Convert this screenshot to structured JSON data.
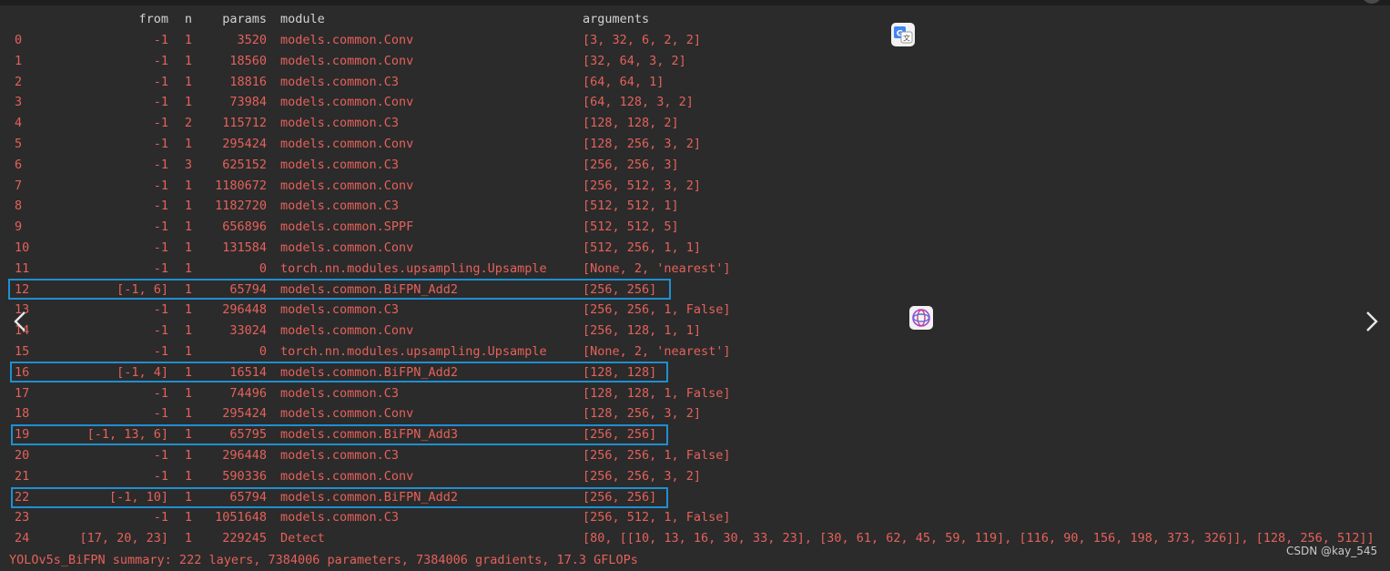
{
  "header": {
    "from": "from",
    "n": "n",
    "params": "params",
    "module": "module",
    "arguments": "arguments"
  },
  "rows": [
    {
      "idx": "0",
      "from": "-1",
      "n": "1",
      "params": "3520",
      "module": "models.common.Conv",
      "arguments": "[3, 32, 6, 2, 2]",
      "highlighted": false
    },
    {
      "idx": "1",
      "from": "-1",
      "n": "1",
      "params": "18560",
      "module": "models.common.Conv",
      "arguments": "[32, 64, 3, 2]",
      "highlighted": false
    },
    {
      "idx": "2",
      "from": "-1",
      "n": "1",
      "params": "18816",
      "module": "models.common.C3",
      "arguments": "[64, 64, 1]",
      "highlighted": false
    },
    {
      "idx": "3",
      "from": "-1",
      "n": "1",
      "params": "73984",
      "module": "models.common.Conv",
      "arguments": "[64, 128, 3, 2]",
      "highlighted": false
    },
    {
      "idx": "4",
      "from": "-1",
      "n": "2",
      "params": "115712",
      "module": "models.common.C3",
      "arguments": "[128, 128, 2]",
      "highlighted": false
    },
    {
      "idx": "5",
      "from": "-1",
      "n": "1",
      "params": "295424",
      "module": "models.common.Conv",
      "arguments": "[128, 256, 3, 2]",
      "highlighted": false
    },
    {
      "idx": "6",
      "from": "-1",
      "n": "3",
      "params": "625152",
      "module": "models.common.C3",
      "arguments": "[256, 256, 3]",
      "highlighted": false
    },
    {
      "idx": "7",
      "from": "-1",
      "n": "1",
      "params": "1180672",
      "module": "models.common.Conv",
      "arguments": "[256, 512, 3, 2]",
      "highlighted": false
    },
    {
      "idx": "8",
      "from": "-1",
      "n": "1",
      "params": "1182720",
      "module": "models.common.C3",
      "arguments": "[512, 512, 1]",
      "highlighted": false
    },
    {
      "idx": "9",
      "from": "-1",
      "n": "1",
      "params": "656896",
      "module": "models.common.SPPF",
      "arguments": "[512, 512, 5]",
      "highlighted": false
    },
    {
      "idx": "10",
      "from": "-1",
      "n": "1",
      "params": "131584",
      "module": "models.common.Conv",
      "arguments": "[512, 256, 1, 1]",
      "highlighted": false
    },
    {
      "idx": "11",
      "from": "-1",
      "n": "1",
      "params": "0",
      "module": "torch.nn.modules.upsampling.Upsample",
      "arguments": "[None, 2, 'nearest']",
      "highlighted": false
    },
    {
      "idx": "12",
      "from": "[-1, 6]",
      "n": "1",
      "params": "65794",
      "module": "models.common.BiFPN_Add2",
      "arguments": "[256, 256]",
      "highlighted": true
    },
    {
      "idx": "13",
      "from": "-1",
      "n": "1",
      "params": "296448",
      "module": "models.common.C3",
      "arguments": "[256, 256, 1, False]",
      "highlighted": false
    },
    {
      "idx": "14",
      "from": "-1",
      "n": "1",
      "params": "33024",
      "module": "models.common.Conv",
      "arguments": "[256, 128, 1, 1]",
      "highlighted": false
    },
    {
      "idx": "15",
      "from": "-1",
      "n": "1",
      "params": "0",
      "module": "torch.nn.modules.upsampling.Upsample",
      "arguments": "[None, 2, 'nearest']",
      "highlighted": false
    },
    {
      "idx": "16",
      "from": "[-1, 4]",
      "n": "1",
      "params": "16514",
      "module": "models.common.BiFPN_Add2",
      "arguments": "[128, 128]",
      "highlighted": true
    },
    {
      "idx": "17",
      "from": "-1",
      "n": "1",
      "params": "74496",
      "module": "models.common.C3",
      "arguments": "[128, 128, 1, False]",
      "highlighted": false
    },
    {
      "idx": "18",
      "from": "-1",
      "n": "1",
      "params": "295424",
      "module": "models.common.Conv",
      "arguments": "[128, 256, 3, 2]",
      "highlighted": false
    },
    {
      "idx": "19",
      "from": "[-1, 13, 6]",
      "n": "1",
      "params": "65795",
      "module": "models.common.BiFPN_Add3",
      "arguments": "[256, 256]",
      "highlighted": true
    },
    {
      "idx": "20",
      "from": "-1",
      "n": "1",
      "params": "296448",
      "module": "models.common.C3",
      "arguments": "[256, 256, 1, False]",
      "highlighted": false
    },
    {
      "idx": "21",
      "from": "-1",
      "n": "1",
      "params": "590336",
      "module": "models.common.Conv",
      "arguments": "[256, 256, 3, 2]",
      "highlighted": false
    },
    {
      "idx": "22",
      "from": "[-1, 10]",
      "n": "1",
      "params": "65794",
      "module": "models.common.BiFPN_Add2",
      "arguments": "[256, 256]",
      "highlighted": true
    },
    {
      "idx": "23",
      "from": "-1",
      "n": "1",
      "params": "1051648",
      "module": "models.common.C3",
      "arguments": "[256, 512, 1, False]",
      "highlighted": false
    },
    {
      "idx": "24",
      "from": "[17, 20, 23]",
      "n": "1",
      "params": "229245",
      "module": "Detect",
      "arguments": "[80, [[10, 13, 16, 30, 33, 23], [30, 61, 62, 45, 59, 119], [116, 90, 156, 198, 373, 326]], [128, 256, 512]]",
      "highlighted": false
    }
  ],
  "summary": "YOLOv5s_BiFPN summary: 222 layers, 7384006 parameters, 7384006 gradients, 17.3 GFLOPs",
  "watermark": "CSDN @kay_545",
  "icons": {
    "translate": "translate-icon",
    "ai_assistant": "ai-assistant-icon",
    "prev": "chevron-left-icon",
    "next": "chevron-right-icon"
  },
  "colors": {
    "background": "#2b2b2b",
    "text": "#e5615a",
    "header_text": "#d2d2d2",
    "highlight_box": "#1f8fd1"
  }
}
